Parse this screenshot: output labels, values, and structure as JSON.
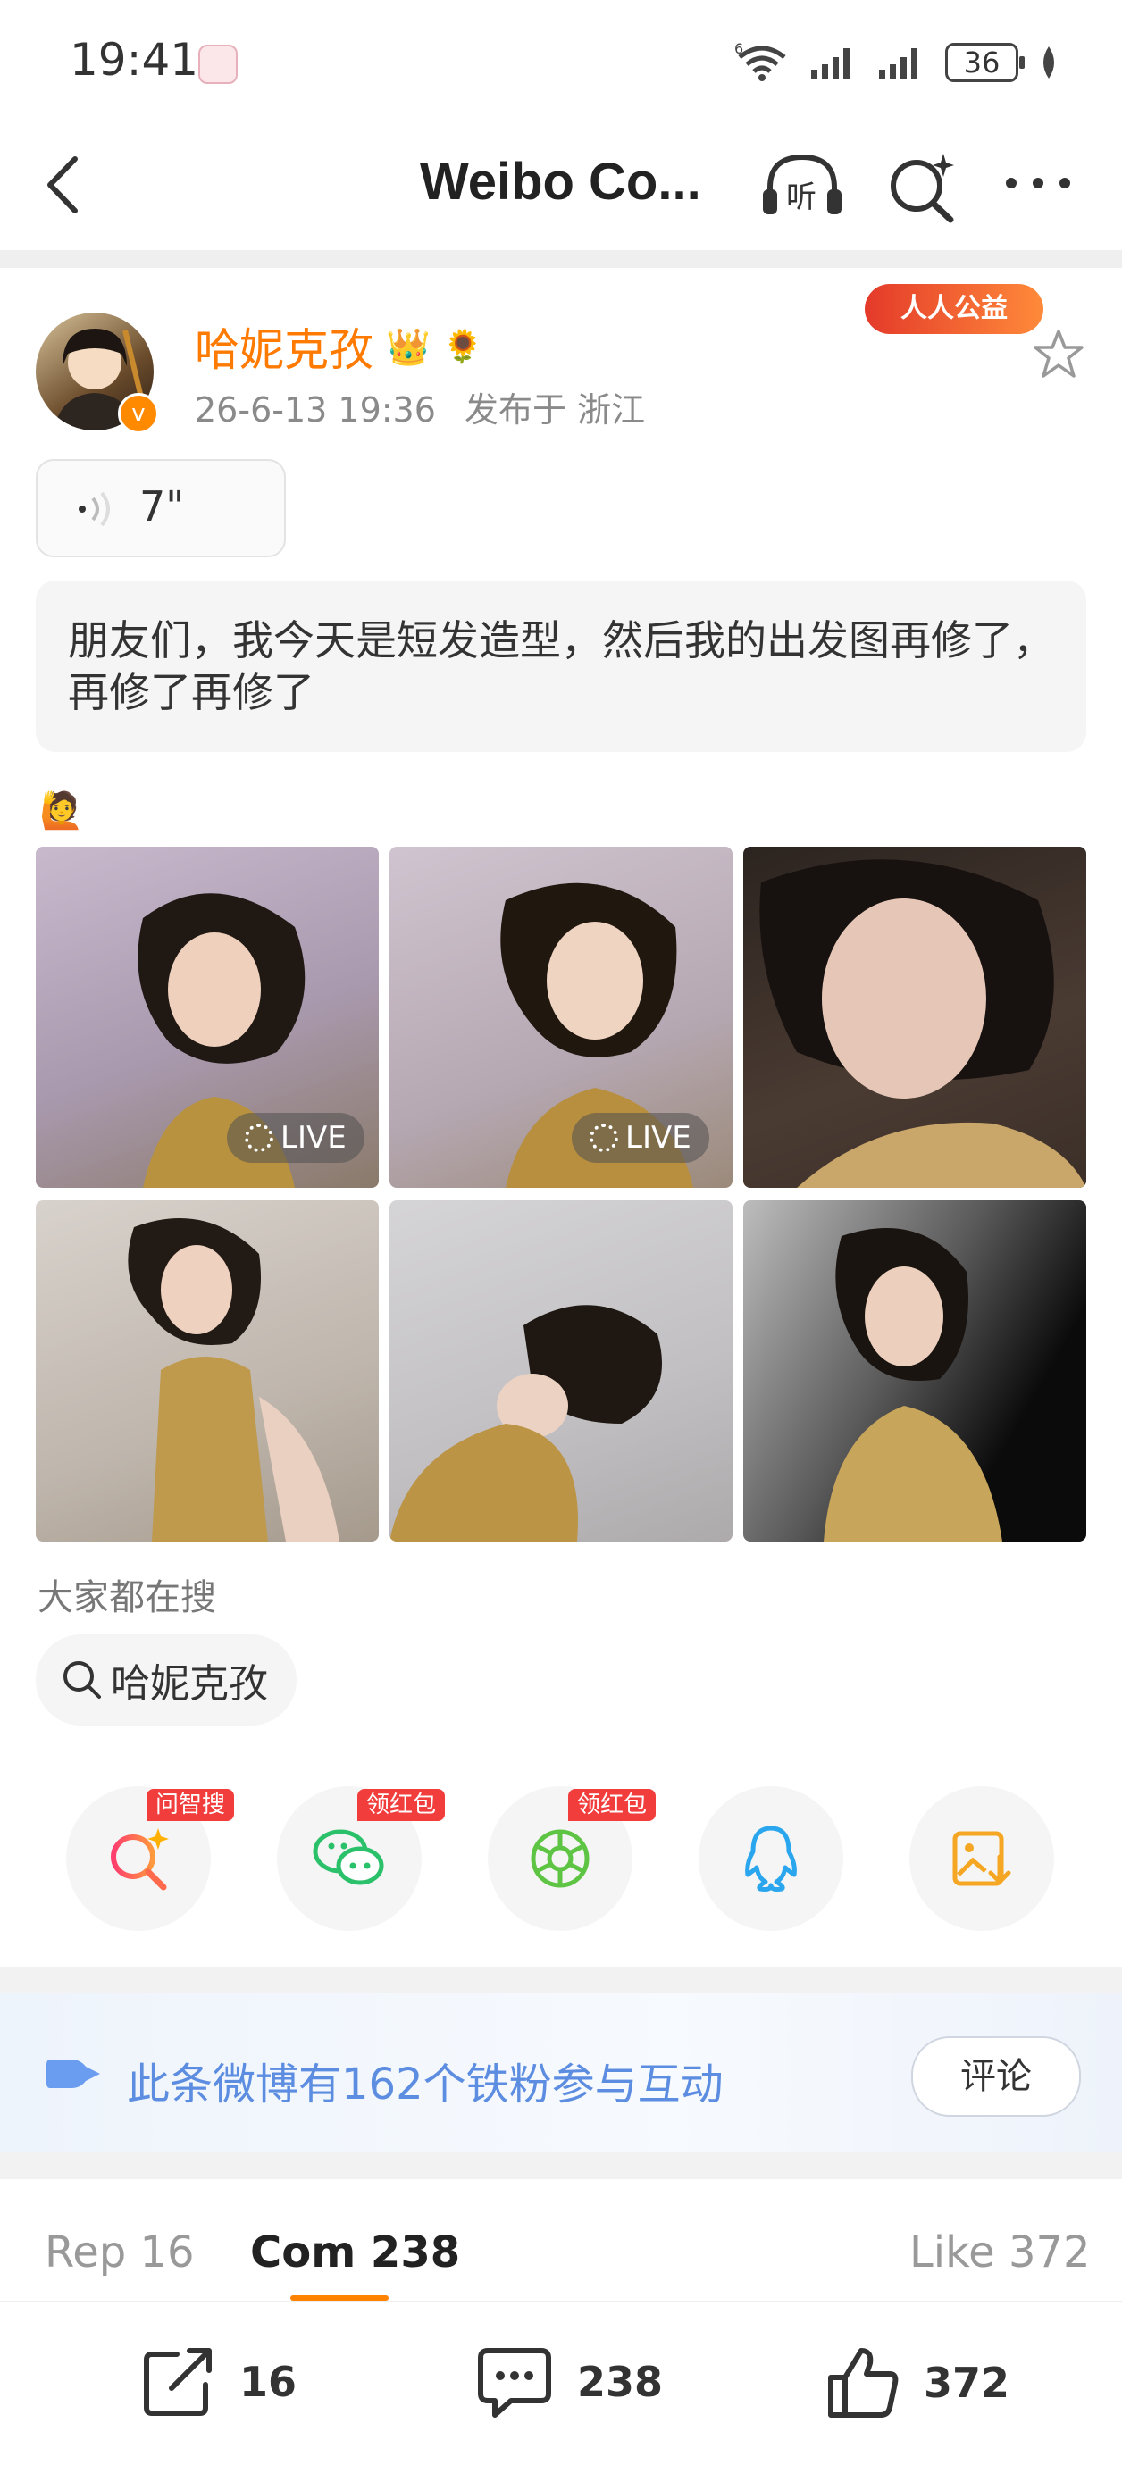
{
  "status_bar": {
    "time": "19:41",
    "network": "6",
    "battery": "36"
  },
  "nav": {
    "title": "Weibo Co...",
    "listen_label": "听"
  },
  "post": {
    "username": "哈妮克孜",
    "time": "26-6-13 19:36",
    "location": "发布于 浙江",
    "charity_badge": "人人公益",
    "audio_duration": "7\"",
    "text": "朋友们，我今天是短发造型，然后我的出发图再修了，再修了再修了",
    "emoji": "🙋",
    "photos": [
      {
        "live": "LIVE"
      },
      {
        "live": "LIVE"
      },
      {
        "live": ""
      },
      {
        "live": ""
      },
      {
        "live": ""
      },
      {
        "live": ""
      }
    ]
  },
  "search": {
    "label": "大家都在搜",
    "chip": "哈妮克孜"
  },
  "share_row": {
    "tags": [
      "问智搜",
      "领红包",
      "领红包"
    ]
  },
  "fans": {
    "text": "此条微博有162个铁粉参与互动",
    "button": "评论"
  },
  "tabs": {
    "repost": "Rep 16",
    "comment": "Com 238",
    "like": "Like 372"
  },
  "actions": {
    "repost": "16",
    "comment": "238",
    "like": "372"
  },
  "colors": {
    "accent": "#ff7a00",
    "link_blue": "#5c8de0"
  }
}
